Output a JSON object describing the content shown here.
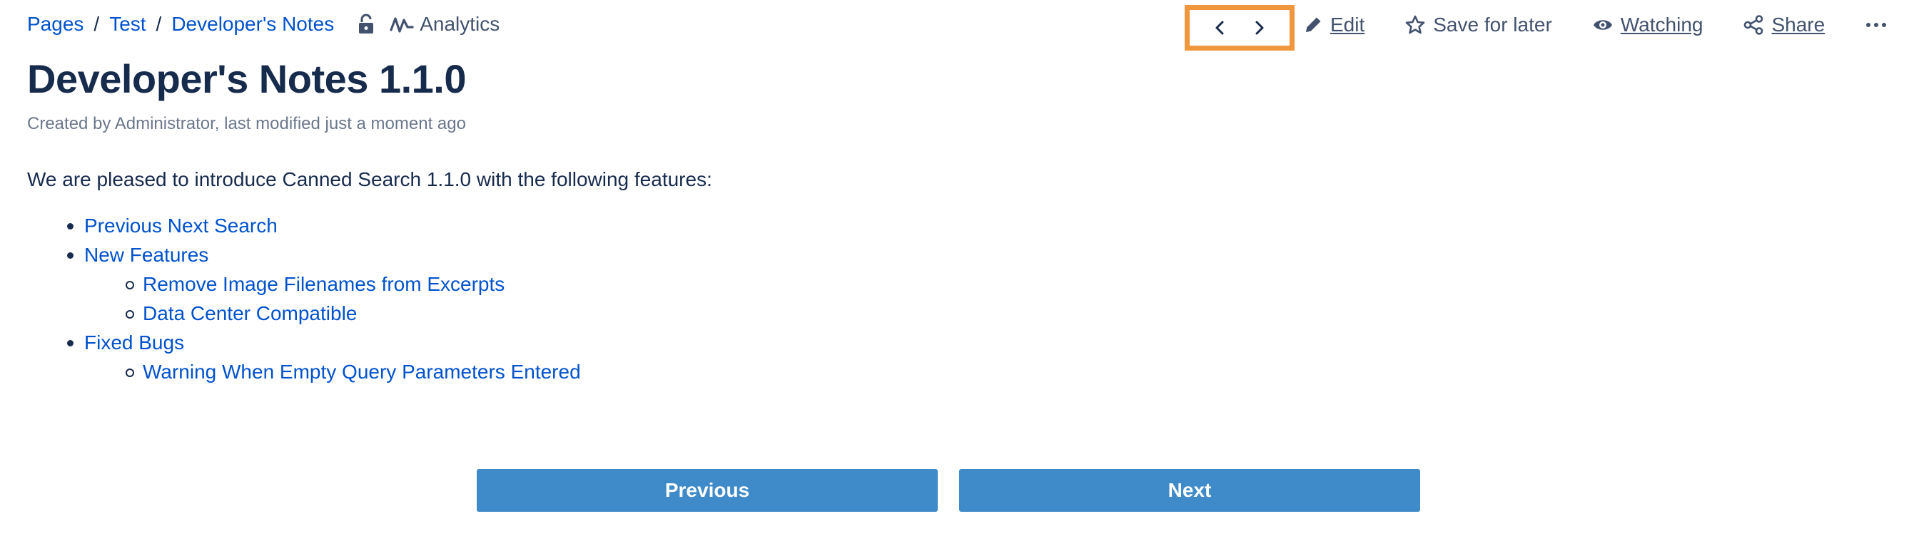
{
  "breadcrumb": {
    "items": [
      "Pages",
      "Test",
      "Developer's Notes"
    ],
    "separator": "/",
    "analytics_label": "Analytics"
  },
  "toolbar": {
    "prev_icon": "chevron-left-icon",
    "next_icon": "chevron-right-icon",
    "edit_label": "Edit",
    "save_label": "Save for later",
    "watching_label": "Watching",
    "share_label": "Share",
    "highlight_color": "#f0963c"
  },
  "page": {
    "title": "Developer's Notes 1.1.0",
    "byline": "Created by Administrator, last modified just a moment ago",
    "intro": "We are pleased to introduce Canned Search 1.1.0 with the following features:"
  },
  "features": [
    {
      "label": "Previous Next Search",
      "level": 1
    },
    {
      "label": "New Features",
      "level": 1
    },
    {
      "label": "Remove Image Filenames from Excerpts",
      "level": 2
    },
    {
      "label": "Data Center Compatible",
      "level": 2
    },
    {
      "label": "Fixed Bugs",
      "level": 1
    },
    {
      "label": "Warning When Empty Query Parameters Entered",
      "level": 2
    }
  ],
  "nav": {
    "previous_label": "Previous",
    "next_label": "Next",
    "button_color": "#3f8ac8"
  },
  "colors": {
    "link": "#0052cc",
    "text": "#172b4d",
    "muted": "#6b778c"
  }
}
